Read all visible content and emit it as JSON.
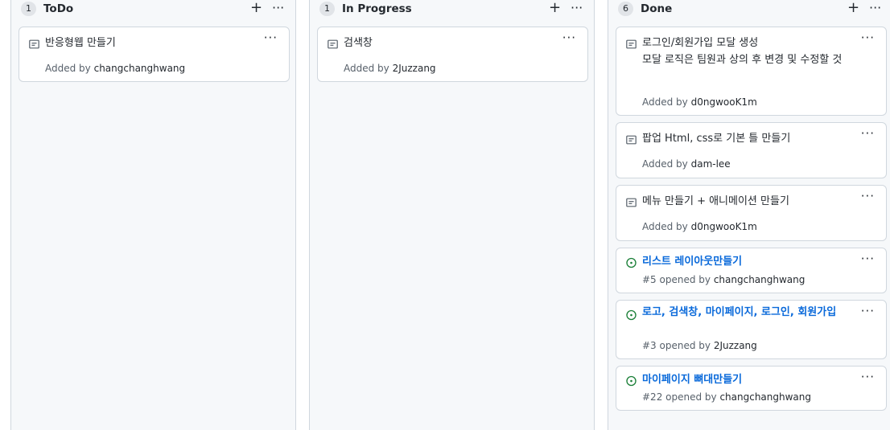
{
  "columns": [
    {
      "count": "1",
      "title": "ToDo",
      "cards": [
        {
          "title": "반응형웹 만들기",
          "meta_prefix": "Added by ",
          "meta_user": "changchanghwang"
        }
      ]
    },
    {
      "count": "1",
      "title": "In Progress",
      "cards": [
        {
          "title": "검색창",
          "meta_prefix": "Added by ",
          "meta_user": "2Juzzang"
        }
      ]
    },
    {
      "count": "6",
      "title": "Done",
      "cards": [
        {
          "title": "로그인/회원가입 모달 생성",
          "title2": "모달 로직은 팀원과 상의 후 변경 및 수정할 것",
          "meta_prefix": "Added by ",
          "meta_user": "d0ngwooK1m"
        },
        {
          "title": "팝업 Html, css로 기본 틀 만들기",
          "meta_prefix": "Added by ",
          "meta_user": "dam-lee"
        },
        {
          "title": "메뉴 만들기 + 애니메이션 만들기",
          "meta_prefix": "Added by ",
          "meta_user": "d0ngwooK1m"
        },
        {
          "title": "리스트 레이아웃만들기",
          "meta_prefix": "#5 opened by ",
          "meta_user": "changchanghwang"
        },
        {
          "title": "로고, 검색창, 마이페이지, 로그인, 회원가입",
          "meta_prefix": "#3 opened by ",
          "meta_user": "2Juzzang"
        },
        {
          "title": "마이페이지 뼈대만들기",
          "meta_prefix": "#22 opened by ",
          "meta_user": "changchanghwang"
        }
      ]
    }
  ],
  "icons": {
    "note": "note-icon",
    "issue_open": "issue-opened-icon",
    "add": "plus-icon",
    "more": "kebab-horizontal-icon"
  },
  "glyphs": {
    "add": "+",
    "more": "···"
  },
  "colors": {
    "issue_open": "#1a7f37",
    "link": "#0969da"
  }
}
